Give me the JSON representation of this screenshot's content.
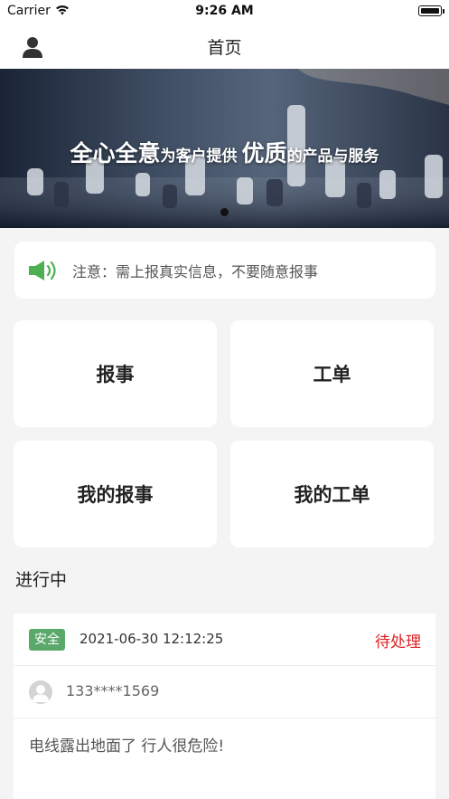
{
  "status_bar": {
    "carrier": "Carrier",
    "time": "9:26 AM"
  },
  "nav": {
    "title": "首页"
  },
  "banner": {
    "text_part1": "全心全意",
    "text_part2": "为客户提供",
    "text_part3": "优质",
    "text_part4": "的产品与服务"
  },
  "notice": {
    "text": "注意：需上报真实信息，不要随意报事"
  },
  "tiles": [
    {
      "label": "报事"
    },
    {
      "label": "工单"
    },
    {
      "label": "我的报事"
    },
    {
      "label": "我的工单"
    }
  ],
  "section": {
    "title": "进行中"
  },
  "order": {
    "tag": "安全",
    "datetime": "2021-06-30 12:12:25",
    "status": "待处理",
    "phone": "133****1569",
    "description": "电线露出地面了 行人很危险!"
  },
  "colors": {
    "tag_green": "#5aa86a",
    "status_red": "#e02020",
    "speaker_green": "#4caf50"
  },
  "icons": {
    "user": "user-icon",
    "speaker": "speaker-icon",
    "wifi": "wifi-icon",
    "battery": "battery-icon",
    "avatar": "avatar-icon"
  }
}
